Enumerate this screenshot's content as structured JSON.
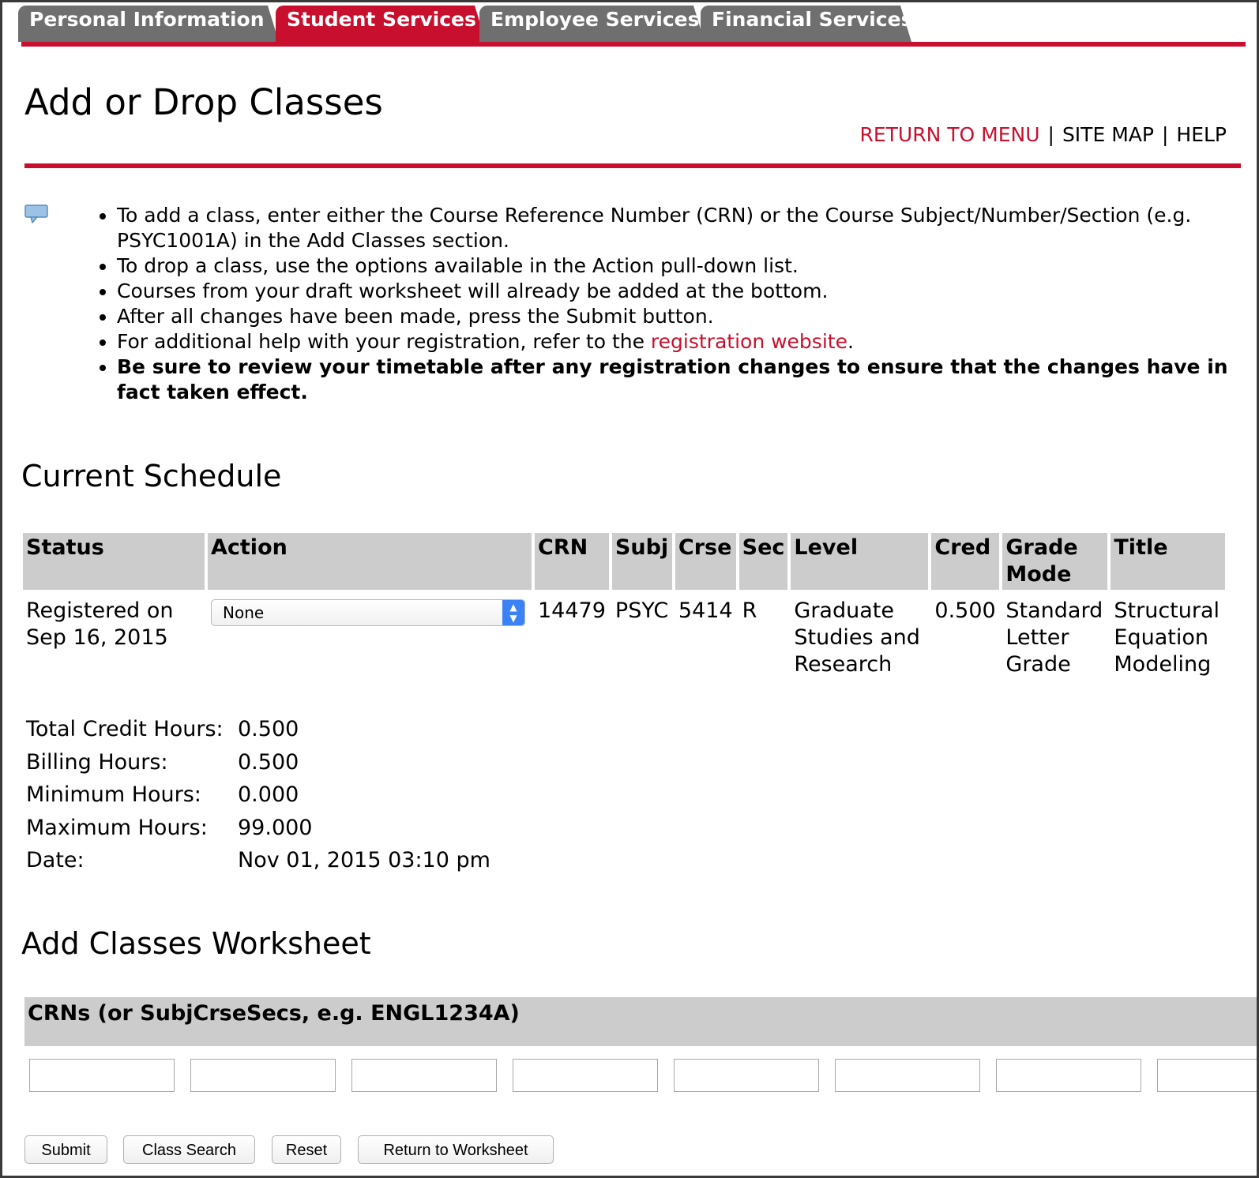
{
  "tabs": [
    {
      "label": "Personal Information",
      "active": false
    },
    {
      "label": "Student Services",
      "active": true
    },
    {
      "label": "Employee Services",
      "active": false
    },
    {
      "label": "Financial Services",
      "active": false
    }
  ],
  "page_title": "Add or Drop Classes",
  "top_links": {
    "return": "RETURN TO MENU",
    "sep1": "|",
    "sitemap": "SITE MAP",
    "sep2": "|",
    "help": "HELP"
  },
  "instructions": {
    "item1": "To add a class, enter either the Course Reference Number (CRN) or the Course Subject/Number/Section (e.g. PSYC1001A) in the Add Classes section.",
    "item2": "To drop a class, use the options available in the Action pull-down list.",
    "item3": "Courses from your draft worksheet will already be added at the bottom.",
    "item4": "After all changes have been made, press the Submit button.",
    "item5_prefix": "For additional help with your registration, refer to the ",
    "item5_link": "registration website",
    "item5_suffix": ".",
    "item6": "Be sure to review your timetable after any registration changes to ensure that the changes have in fact taken effect."
  },
  "current_schedule": {
    "heading": "Current Schedule",
    "headers": {
      "status": "Status",
      "action": "Action",
      "crn": "CRN",
      "subj": "Subj",
      "crse": "Crse",
      "sec": "Sec",
      "level": "Level",
      "cred": "Cred",
      "grade_mode": "Grade Mode",
      "title": "Title"
    },
    "row": {
      "status": "Registered on Sep 16, 2015",
      "action": "None",
      "crn": "14479",
      "subj": "PSYC",
      "crse": "5414",
      "sec": "R",
      "level": "Graduate Studies and Research",
      "cred": "0.500",
      "grade_mode": "Standard Letter Grade",
      "title": "Structural Equation Modeling"
    }
  },
  "totals": {
    "total_credit_label": "Total Credit Hours:",
    "total_credit": "0.500",
    "billing_label": "Billing Hours:",
    "billing": "0.500",
    "minimum_label": "Minimum Hours:",
    "minimum": "0.000",
    "maximum_label": "Maximum Hours:",
    "maximum": "99.000",
    "date_label": "Date:",
    "date": "Nov 01, 2015 03:10 pm"
  },
  "worksheet": {
    "heading": "Add Classes Worksheet",
    "column_header": "CRNs (or SubjCrseSecs, e.g. ENGL1234A)",
    "inputs": [
      "",
      "",
      "",
      "",
      "",
      "",
      "",
      ""
    ]
  },
  "buttons": {
    "submit": "Submit",
    "class_search": "Class Search",
    "reset": "Reset",
    "return_worksheet": "Return to Worksheet"
  },
  "colors": {
    "accent": "#c8102e",
    "tab_inactive": "#6f6f6f",
    "header_gray": "#cccccc"
  },
  "icons": {
    "info": "speech-bubble-icon",
    "select": "up-down-chevron-icon"
  }
}
